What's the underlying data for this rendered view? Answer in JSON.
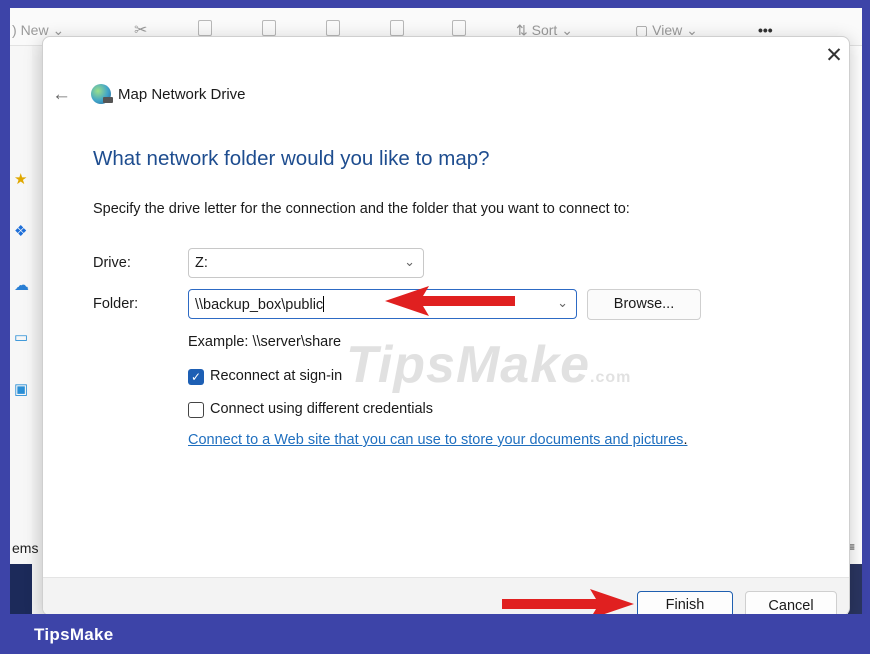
{
  "explorer": {
    "toolbar": {
      "new_label": "New",
      "sort_label": "Sort",
      "view_label": "View",
      "more_label": "•••"
    },
    "sidebar_fragment": "ems"
  },
  "dialog": {
    "title": "Map Network Drive",
    "close_glyph": "✕",
    "back_glyph": "←",
    "heading": "What network folder would you like to map?",
    "instructions": "Specify the drive letter for the connection and the folder that you want to connect to:",
    "drive": {
      "label": "Drive:",
      "value": "Z:"
    },
    "folder": {
      "label": "Folder:",
      "value": "\\\\backup_box\\public"
    },
    "browse_label": "Browse...",
    "example": "Example: \\\\server\\share",
    "reconnect": {
      "label": "Reconnect at sign-in",
      "checked": true
    },
    "different_credentials": {
      "label": "Connect using different credentials",
      "checked": false
    },
    "web_link": "Connect to a Web site that you can use to store your documents and pictures",
    "web_link_suffix": ".",
    "finish_label": "Finish",
    "cancel_label": "Cancel"
  },
  "watermark": {
    "main": "TipsMake",
    "suffix": ".com"
  },
  "brand": "TipsMake",
  "colors": {
    "frame": "#3d44a8",
    "heading": "#1e4d8f",
    "link": "#1f6fbf",
    "checkbox": "#1d5fb4",
    "annotation_arrow": "#e02020"
  }
}
